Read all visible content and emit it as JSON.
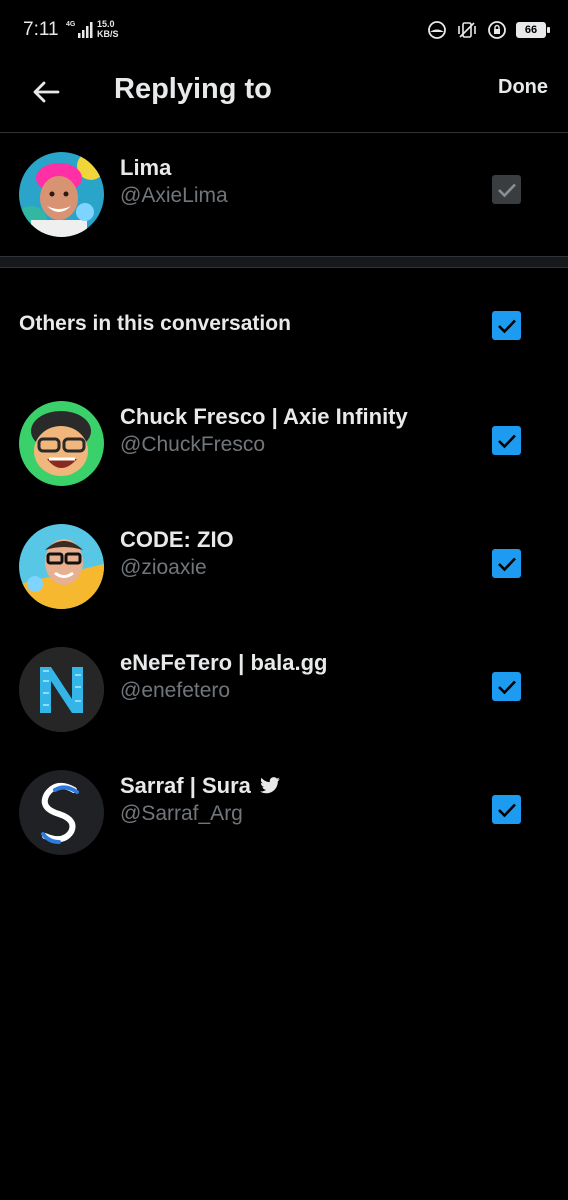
{
  "status_bar": {
    "time": "7:11",
    "network": "4G",
    "speed_value": "15.0",
    "speed_unit": "KB/S",
    "battery": "66"
  },
  "header": {
    "title": "Replying to",
    "done_label": "Done"
  },
  "primary": {
    "name": "Lima",
    "handle": "@AxieLima",
    "checked": true
  },
  "others": {
    "label": "Others in this conversation",
    "checked": true,
    "people": [
      {
        "name": "Chuck Fresco | Axie Infinity",
        "handle": "@ChuckFresco",
        "checked": true
      },
      {
        "name": "CODE: ZIO",
        "handle": "@zioaxie",
        "checked": true
      },
      {
        "name": "eNeFeTero | bala.gg",
        "handle": "@enefetero",
        "checked": true,
        "avatar_letter": "N"
      },
      {
        "name": "Sarraf | Sura",
        "handle": "@Sarraf_Arg",
        "checked": true,
        "badge_icon": "twitter-bird-icon"
      }
    ]
  },
  "colors": {
    "accent": "#1d9bf0",
    "background": "#000000",
    "text_primary": "#e7e9ea",
    "text_secondary": "#71767b",
    "checkbox_disabled": "#3a3d40"
  }
}
